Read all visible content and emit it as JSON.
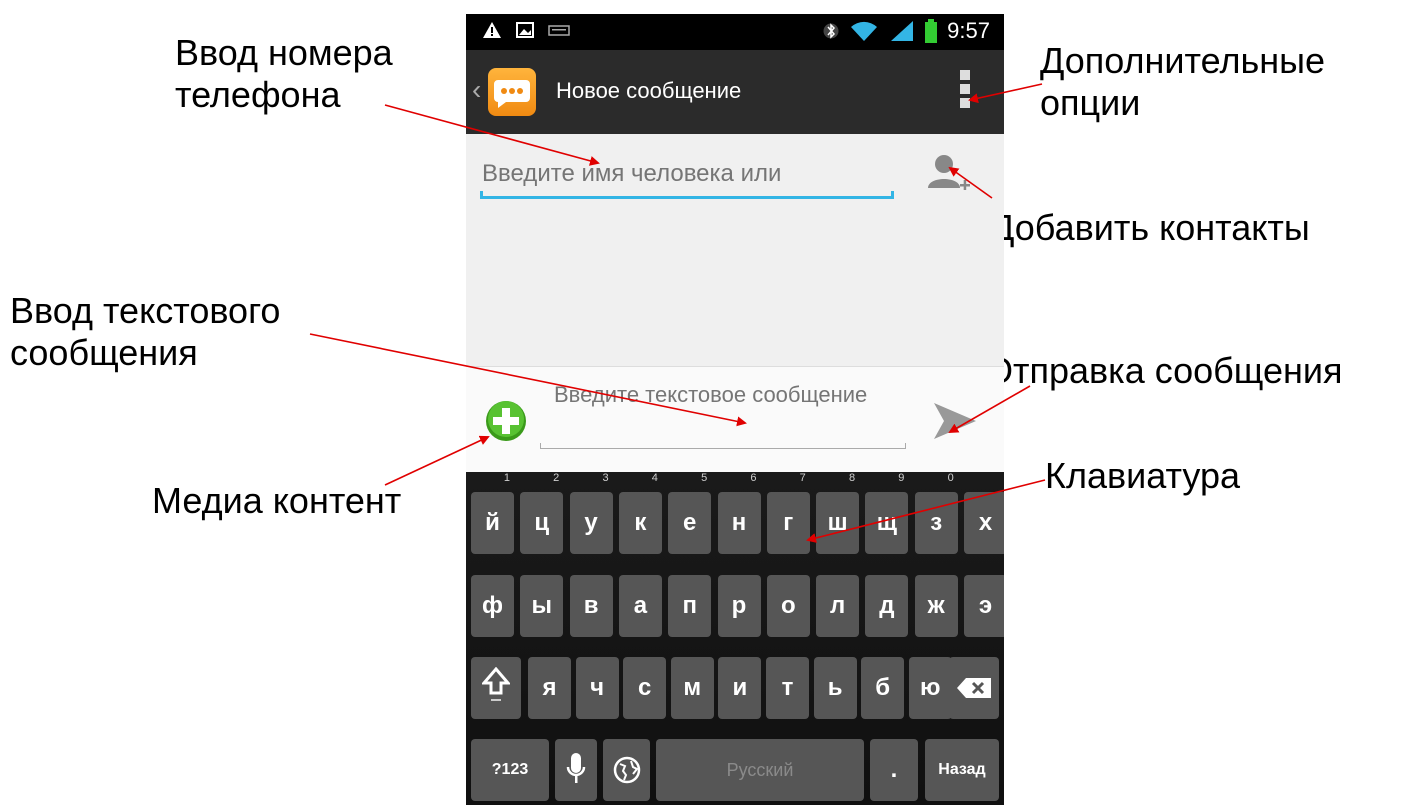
{
  "annotations": {
    "phone_input_line1": "Ввод номера",
    "phone_input_line2": "телефона",
    "more_options_line1": "Дополнительные",
    "more_options_line2": "опции",
    "add_contacts": "Добавить контакты",
    "text_input_line1": "Ввод текстового",
    "text_input_line2": "сообщения",
    "send_message": "Отправка сообщения",
    "media_content": "Медиа контент",
    "keyboard": "Клавиатура"
  },
  "status_bar": {
    "time": "9:57"
  },
  "action_bar": {
    "title": "Новое сообщение"
  },
  "recipient": {
    "placeholder": "Введите имя человека или"
  },
  "compose": {
    "placeholder": "Введите текстовое сообщение"
  },
  "keyboard": {
    "row1": [
      {
        "label": "й",
        "sup": "1"
      },
      {
        "label": "ц",
        "sup": "2"
      },
      {
        "label": "у",
        "sup": "3"
      },
      {
        "label": "к",
        "sup": "4"
      },
      {
        "label": "е",
        "sup": "5"
      },
      {
        "label": "н",
        "sup": "6"
      },
      {
        "label": "г",
        "sup": "7"
      },
      {
        "label": "ш",
        "sup": "8"
      },
      {
        "label": "щ",
        "sup": "9"
      },
      {
        "label": "з",
        "sup": "0"
      },
      {
        "label": "х",
        "sup": ""
      }
    ],
    "row2": [
      "ф",
      "ы",
      "в",
      "а",
      "п",
      "р",
      "о",
      "л",
      "д",
      "ж",
      "э"
    ],
    "row3": [
      "я",
      "ч",
      "с",
      "м",
      "и",
      "т",
      "ь",
      "б",
      "ю"
    ],
    "symbols_label": "?123",
    "space_label": "Русский",
    "period_label": ".",
    "enter_label": "Назад"
  }
}
